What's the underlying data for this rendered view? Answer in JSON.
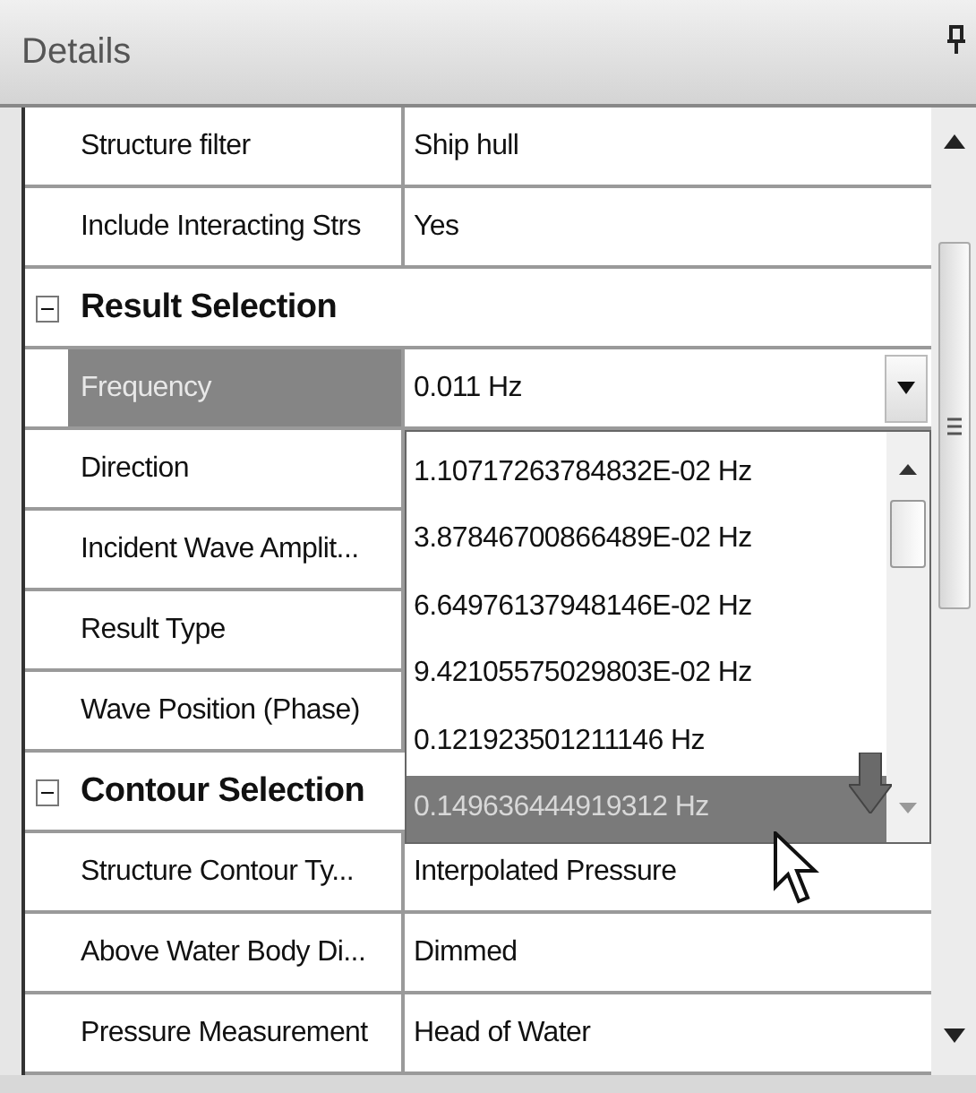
{
  "panel": {
    "title": "Details"
  },
  "rows": [
    {
      "kind": "property",
      "name": "Structure filter",
      "value": "Ship hull",
      "selected": false
    },
    {
      "kind": "property",
      "name": "Include Interacting Strs",
      "value": "Yes",
      "selected": false
    },
    {
      "kind": "category",
      "name": "Result Selection",
      "expanded": true
    },
    {
      "kind": "property",
      "name": "Frequency",
      "value": "0.011 Hz",
      "selected": true,
      "dropdown": true
    },
    {
      "kind": "property",
      "name": "Direction",
      "selected": false
    },
    {
      "kind": "property",
      "name": "Incident Wave Amplit...",
      "selected": false
    },
    {
      "kind": "property",
      "name": "Result Type",
      "selected": false
    },
    {
      "kind": "property",
      "name": "Wave Position (Phase)",
      "selected": false
    },
    {
      "kind": "category",
      "name": "Contour Selection",
      "expanded": true
    },
    {
      "kind": "property",
      "name": "Structure Contour Ty...",
      "value": "Interpolated Pressure",
      "selected": false
    },
    {
      "kind": "property",
      "name": "Above Water Body Di...",
      "value": "Dimmed",
      "selected": false
    },
    {
      "kind": "property",
      "name": "Pressure Measurement",
      "value": "Head of Water",
      "selected": false
    }
  ],
  "dropdown": {
    "items": [
      {
        "label": "1.10717263784832E-02 Hz",
        "selected": false
      },
      {
        "label": "3.87846700866489E-02 Hz",
        "selected": false
      },
      {
        "label": "6.64976137948146E-02 Hz",
        "selected": false
      },
      {
        "label": "9.42105575029803E-02 Hz",
        "selected": false
      },
      {
        "label": "0.121923501211146 Hz",
        "selected": false
      },
      {
        "label": "0.149636444919312 Hz",
        "selected": true
      }
    ]
  }
}
